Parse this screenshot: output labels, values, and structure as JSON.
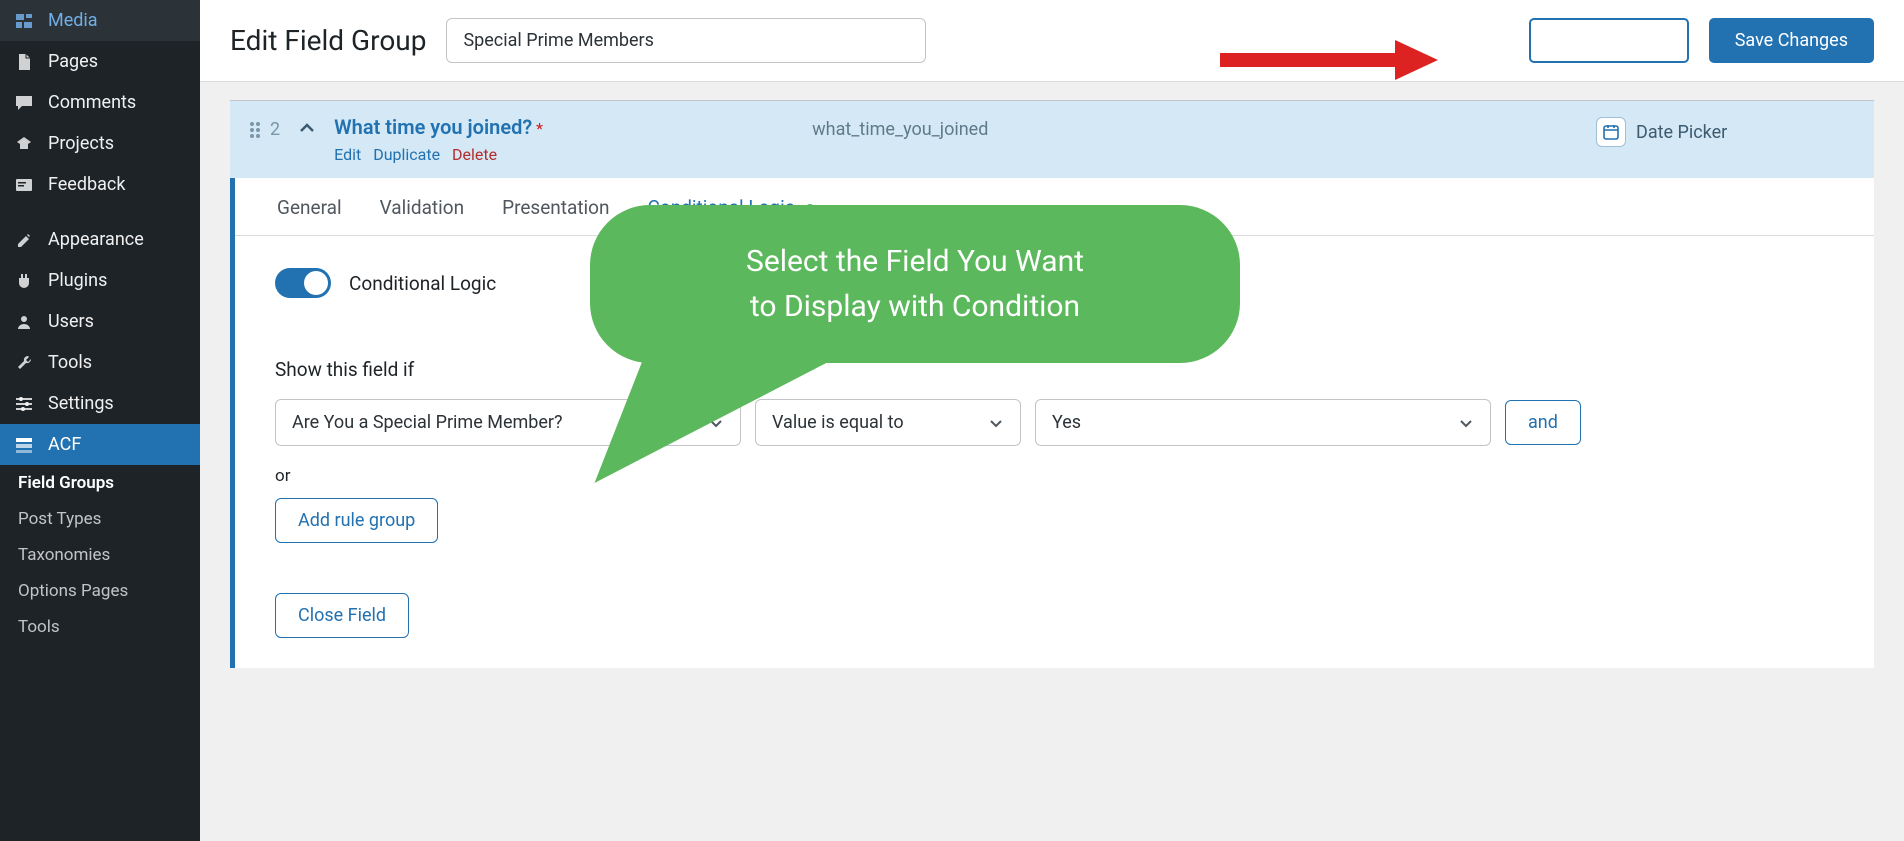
{
  "sidebar": {
    "items": [
      {
        "label": "Media"
      },
      {
        "label": "Pages"
      },
      {
        "label": "Comments"
      },
      {
        "label": "Projects"
      },
      {
        "label": "Feedback"
      },
      {
        "label": "Appearance"
      },
      {
        "label": "Plugins"
      },
      {
        "label": "Users"
      },
      {
        "label": "Tools"
      },
      {
        "label": "Settings"
      },
      {
        "label": "ACF"
      }
    ],
    "sub": [
      {
        "label": "Field Groups"
      },
      {
        "label": "Post Types"
      },
      {
        "label": "Taxonomies"
      },
      {
        "label": "Options Pages"
      },
      {
        "label": "Tools"
      }
    ]
  },
  "header": {
    "title": "Edit Field Group",
    "title_value": "Special Prime Members",
    "save_label": "Save Changes"
  },
  "field_row": {
    "order": "2",
    "label": "What time you joined?",
    "name": "what_time_you_joined",
    "type": "Date Picker",
    "actions": {
      "edit": "Edit",
      "duplicate": "Duplicate",
      "delete": "Delete"
    }
  },
  "tabs": {
    "general": "General",
    "validation": "Validation",
    "presentation": "Presentation",
    "conditional": "Conditional Logic"
  },
  "panel": {
    "toggle_label": "Conditional Logic",
    "rule_label": "Show this field if",
    "field_select": "Are You a Special Prime Member?",
    "op_select": "Value is equal to",
    "val_select": "Yes",
    "and_btn": "and",
    "or_label": "or",
    "add_rule": "Add rule group",
    "close_field": "Close Field"
  },
  "callout": {
    "line1": "Select the Field You Want",
    "line2": "to Display with Condition"
  }
}
